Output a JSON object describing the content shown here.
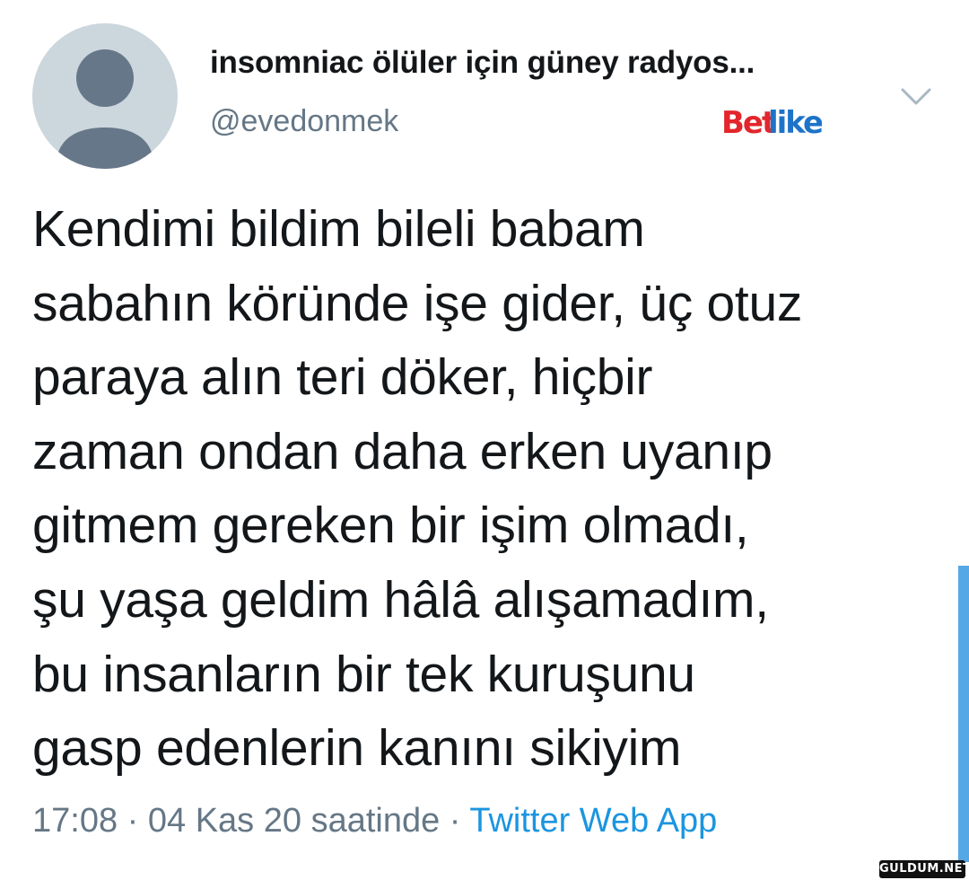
{
  "profile": {
    "display_name": "insomniac ölüler için güney radyos...",
    "handle": "@evedonmek"
  },
  "header": {
    "watermark_logo": "Betlike",
    "menu_icon": "chevron-down-icon"
  },
  "tweet": {
    "text": "Kendimi bildim bileli babam\nsabahın köründe işe gider, üç otuz\nparaya alın teri döker, hiçbir\nzaman ondan daha erken uyanıp\ngitmem gereken bir işim olmadı,\nşu yaşa geldim hâlâ alışamadım,\nbu insanların bir tek kuruşunu\ngasp edenlerin kanını sikiyim"
  },
  "meta": {
    "time": "17:08",
    "separator": " · ",
    "date": "04 Kas 20 saatinde",
    "source": "Twitter Web App"
  },
  "footer": {
    "corner_watermark": "GULDUM.NET"
  },
  "colors": {
    "text": "#14171a",
    "secondary": "#657786",
    "link": "#1b95e0",
    "avatar_bg": "#ccd6dd",
    "avatar_figure": "#67778a",
    "logo_red": "#e2262b",
    "logo_blue": "#1d73c9",
    "scroll_thumb": "#55a8e6"
  }
}
